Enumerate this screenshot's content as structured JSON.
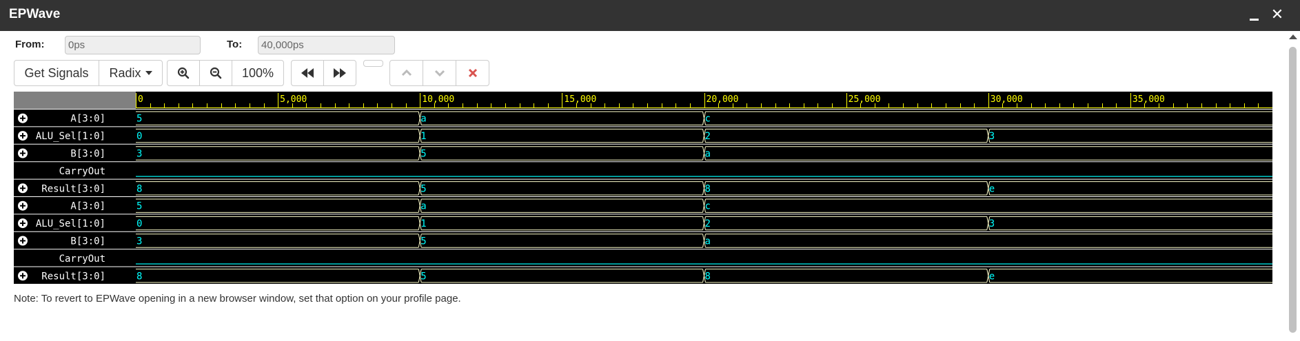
{
  "window": {
    "title": "EPWave"
  },
  "range": {
    "from_label": "From:",
    "from_value": "0ps",
    "to_label": "To:",
    "to_value": "40,000ps"
  },
  "toolbar": {
    "get_signals": "Get Signals",
    "radix": "Radix",
    "zoom_level": "100%"
  },
  "timeline": {
    "ticks": [
      "0",
      "5,000",
      "10,000",
      "15,000",
      "20,000",
      "25,000",
      "30,000",
      "35,000"
    ]
  },
  "signals": [
    {
      "name": "A[3:0]",
      "type": "bus",
      "expand": true,
      "segments": [
        [
          "5",
          0
        ],
        [
          "a",
          10000
        ],
        [
          "c",
          20000
        ]
      ]
    },
    {
      "name": "ALU_Sel[1:0]",
      "type": "bus",
      "expand": true,
      "segments": [
        [
          "0",
          0
        ],
        [
          "1",
          10000
        ],
        [
          "2",
          20000
        ],
        [
          "3",
          30000
        ]
      ]
    },
    {
      "name": "B[3:0]",
      "type": "bus",
      "expand": true,
      "segments": [
        [
          "3",
          0
        ],
        [
          "5",
          10000
        ],
        [
          "a",
          20000
        ]
      ]
    },
    {
      "name": "CarryOut",
      "type": "bit",
      "expand": false,
      "segments": []
    },
    {
      "name": "Result[3:0]",
      "type": "bus",
      "expand": true,
      "segments": [
        [
          "8",
          0
        ],
        [
          "5",
          10000
        ],
        [
          "8",
          20000
        ],
        [
          "e",
          30000
        ]
      ]
    },
    {
      "name": "A[3:0]",
      "type": "bus",
      "expand": true,
      "segments": [
        [
          "5",
          0
        ],
        [
          "a",
          10000
        ],
        [
          "c",
          20000
        ]
      ]
    },
    {
      "name": "ALU_Sel[1:0]",
      "type": "bus",
      "expand": true,
      "segments": [
        [
          "0",
          0
        ],
        [
          "1",
          10000
        ],
        [
          "2",
          20000
        ],
        [
          "3",
          30000
        ]
      ]
    },
    {
      "name": "B[3:0]",
      "type": "bus",
      "expand": true,
      "segments": [
        [
          "3",
          0
        ],
        [
          "5",
          10000
        ],
        [
          "a",
          20000
        ]
      ]
    },
    {
      "name": "CarryOut",
      "type": "bit",
      "expand": false,
      "segments": []
    },
    {
      "name": "Result[3:0]",
      "type": "bus",
      "expand": true,
      "segments": [
        [
          "8",
          0
        ],
        [
          "5",
          10000
        ],
        [
          "8",
          20000
        ],
        [
          "e",
          30000
        ]
      ]
    }
  ],
  "note": "Note: To revert to EPWave opening in a new browser window, set that option on your profile page.",
  "colors": {
    "titlebar": "#333333",
    "wave_bg": "#000000",
    "ruler_bg": "#808080",
    "ruler_text": "#ffff00",
    "bus_value": "#00ffff",
    "bus_line": "#ffffcc",
    "bit_line": "#00cccc",
    "delete": "#d9534f",
    "disabled_arrow": "#bbbbbb"
  }
}
